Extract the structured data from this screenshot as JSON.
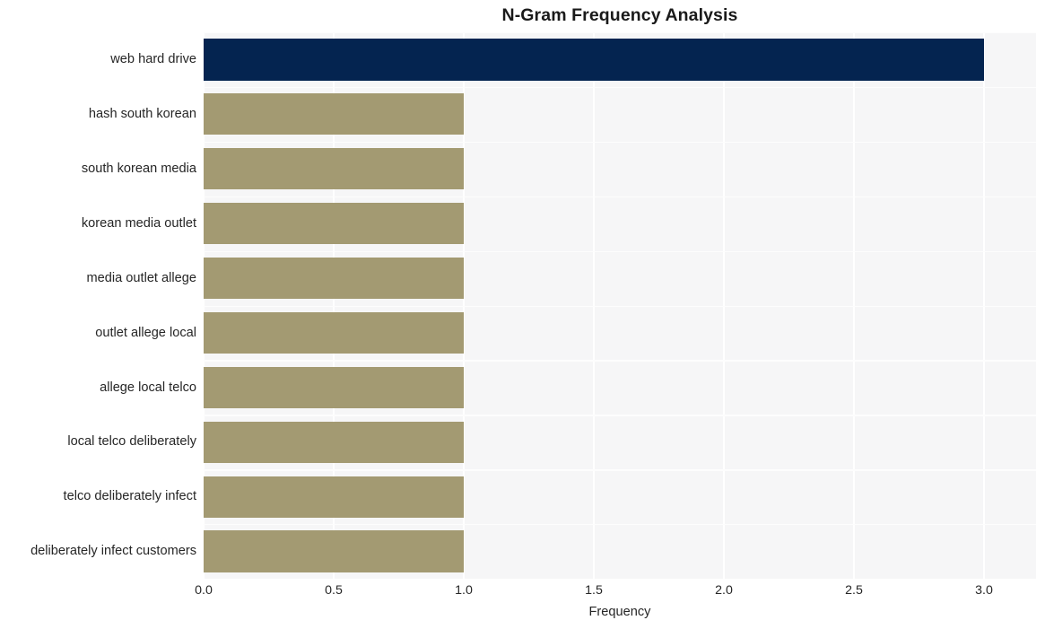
{
  "chart_data": {
    "type": "bar",
    "orientation": "horizontal",
    "title": "N-Gram Frequency Analysis",
    "xlabel": "Frequency",
    "ylabel": "",
    "xlim": [
      0,
      3.2
    ],
    "xticks": [
      "0.0",
      "0.5",
      "1.0",
      "1.5",
      "2.0",
      "2.5",
      "3.0"
    ],
    "xtick_values": [
      0.0,
      0.5,
      1.0,
      1.5,
      2.0,
      2.5,
      3.0
    ],
    "grid": true,
    "legend": "none",
    "categories": [
      "web hard drive",
      "hash south korean",
      "south korean media",
      "korean media outlet",
      "media outlet allege",
      "outlet allege local",
      "allege local telco",
      "local telco deliberately",
      "telco deliberately infect",
      "deliberately infect customers"
    ],
    "values": [
      3,
      1,
      1,
      1,
      1,
      1,
      1,
      1,
      1,
      1
    ],
    "bar_colors": [
      "#042450",
      "#a39a72",
      "#a39a72",
      "#a39a72",
      "#a39a72",
      "#a39a72",
      "#a39a72",
      "#a39a72",
      "#a39a72",
      "#a39a72"
    ]
  },
  "style": {
    "figure_background": "#ffffff",
    "plot_background": "#f6f6f7",
    "gridline_color": "#ffffff",
    "text_color": "#262626",
    "title_color": "#1a1a1a",
    "highlight_color": "#042450",
    "bar_color": "#a39a72"
  }
}
